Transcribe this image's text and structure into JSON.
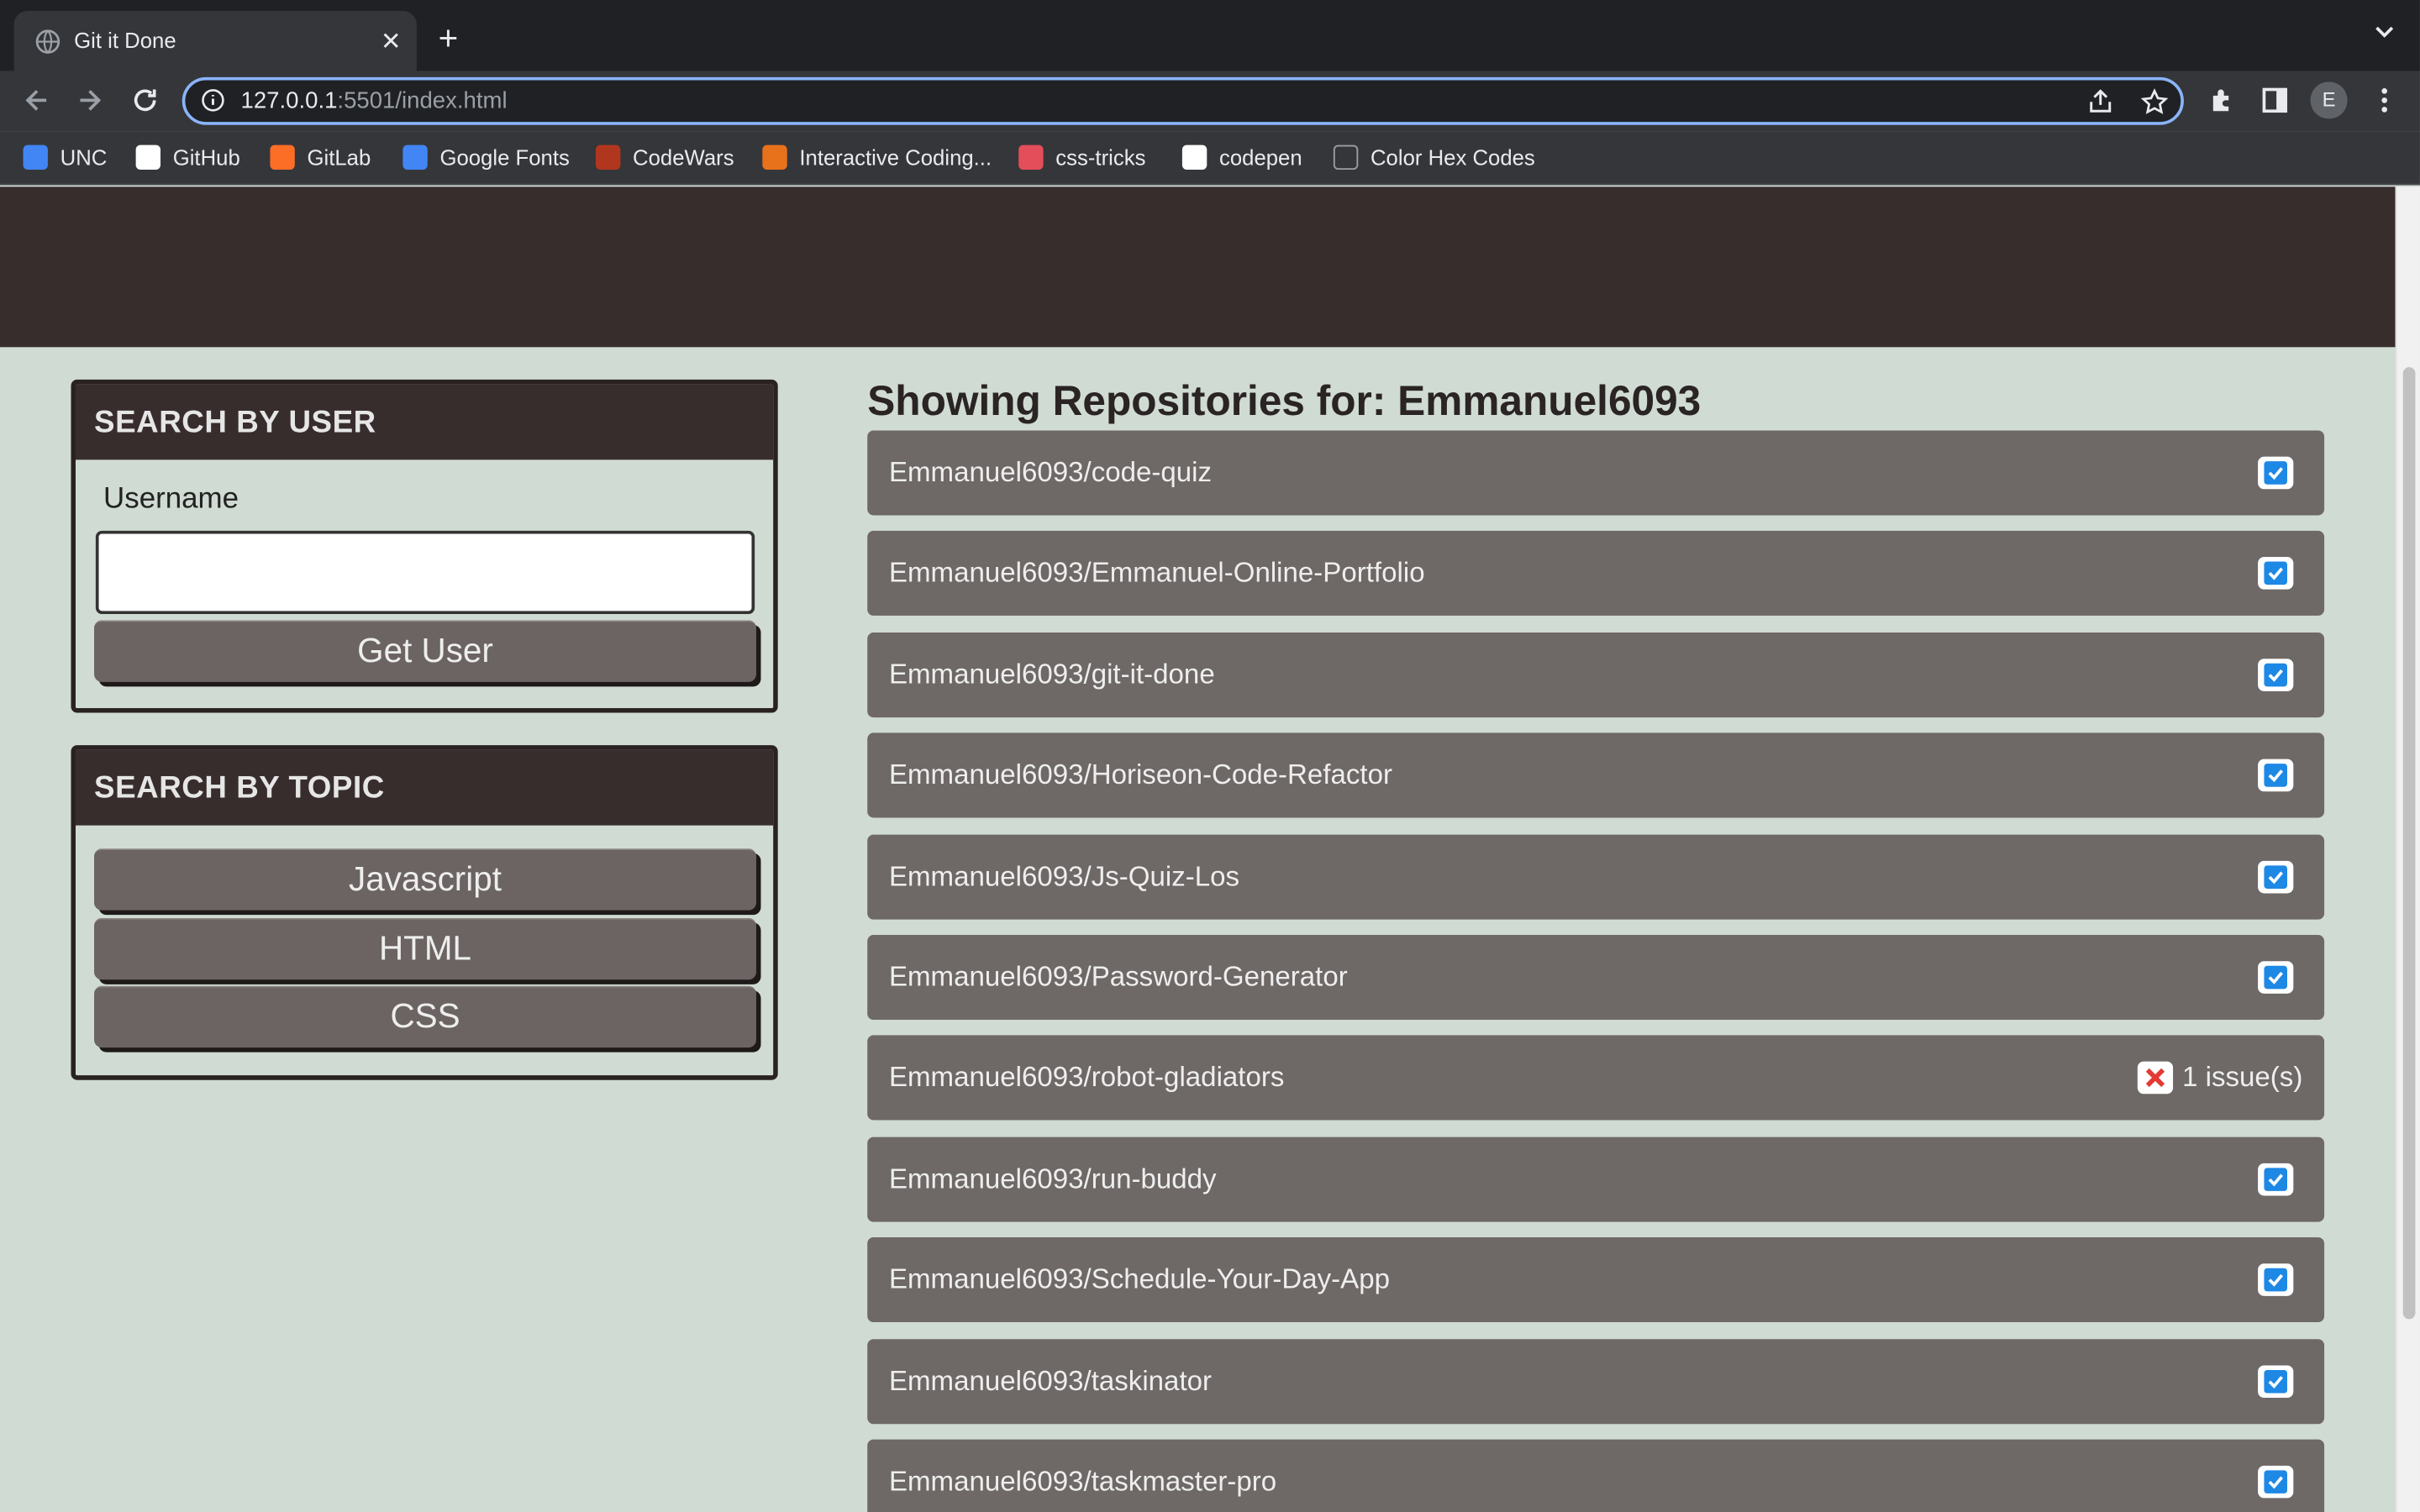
{
  "browser": {
    "tab_title": "Git it Done",
    "url_host": "127.0.0.1",
    "url_rest": ":5501/index.html",
    "avatar_letter": "E",
    "bookmarks": [
      {
        "label": "UNC",
        "icon": "unc-icon",
        "color": "#4285f4"
      },
      {
        "label": "GitHub",
        "icon": "github-icon",
        "color": "#ffffff"
      },
      {
        "label": "GitLab",
        "icon": "gitlab-icon",
        "color": "#fc6d26"
      },
      {
        "label": "Google Fonts",
        "icon": "google-fonts-icon",
        "color": "#4285f4"
      },
      {
        "label": "CodeWars",
        "icon": "codewars-icon",
        "color": "#b1361e"
      },
      {
        "label": "Interactive Coding...",
        "icon": "interactive-coding-icon",
        "color": "#e8711c"
      },
      {
        "label": "css-tricks",
        "icon": "css-tricks-icon",
        "color": "#e44d5a"
      },
      {
        "label": "codepen",
        "icon": "codepen-icon",
        "color": "#ffffff"
      },
      {
        "label": "Color Hex Codes",
        "icon": "color-hex-icon",
        "color": "#000000"
      }
    ]
  },
  "page": {
    "colors": {
      "hero": "#382d2d",
      "background": "#d0dbd3",
      "repo": "#6e6866",
      "check": "#1e88e5",
      "error": "#e53935"
    },
    "search_user": {
      "header": "SEARCH BY USER",
      "label": "Username",
      "input_value": "",
      "button": "Get User"
    },
    "search_topic": {
      "header": "SEARCH BY TOPIC",
      "buttons": [
        "Javascript",
        "HTML",
        "CSS"
      ]
    },
    "repos_heading": "Showing Repositories for: Emmanuel6093",
    "repos": [
      {
        "name": "Emmanuel6093/code-quiz",
        "status": "ok"
      },
      {
        "name": "Emmanuel6093/Emmanuel-Online-Portfolio",
        "status": "ok"
      },
      {
        "name": "Emmanuel6093/git-it-done",
        "status": "ok"
      },
      {
        "name": "Emmanuel6093/Horiseon-Code-Refactor",
        "status": "ok"
      },
      {
        "name": "Emmanuel6093/Js-Quiz-Los",
        "status": "ok"
      },
      {
        "name": "Emmanuel6093/Password-Generator",
        "status": "ok"
      },
      {
        "name": "Emmanuel6093/robot-gladiators",
        "status": "issues",
        "issues": "1 issue(s)"
      },
      {
        "name": "Emmanuel6093/run-buddy",
        "status": "ok"
      },
      {
        "name": "Emmanuel6093/Schedule-Your-Day-App",
        "status": "ok"
      },
      {
        "name": "Emmanuel6093/taskinator",
        "status": "ok"
      },
      {
        "name": "Emmanuel6093/taskmaster-pro",
        "status": "ok"
      }
    ]
  }
}
